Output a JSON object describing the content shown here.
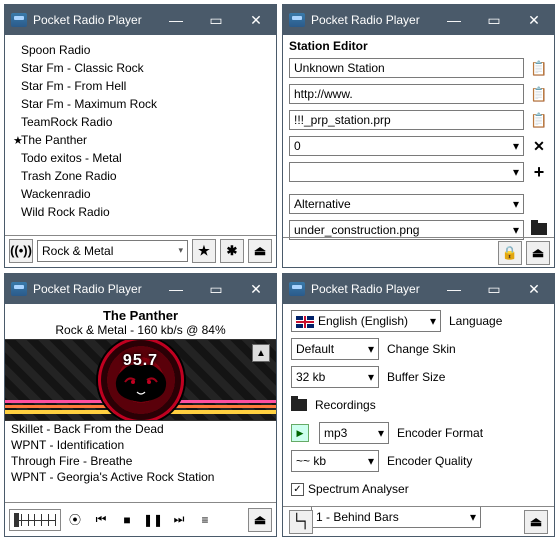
{
  "app_title": "Pocket Radio Player",
  "win_tl": {
    "stations": [
      "Spoon Radio",
      "Star Fm - Classic Rock",
      "Star Fm - From Hell",
      "Star Fm - Maximum Rock",
      "TeamRock Radio",
      "The Panther",
      "Todo exitos - Metal",
      "Trash Zone Radio",
      "Wackenradio",
      "Wild Rock Radio"
    ],
    "starred_index": 5,
    "genre": "Rock & Metal"
  },
  "win_tr": {
    "heading": "Station Editor",
    "name": "Unknown Station",
    "url": "http://www.",
    "file": "!!!_prp_station.prp",
    "bitrate": "0",
    "extra": "",
    "genre": "Alternative",
    "image": "under_construction.png"
  },
  "win_bl": {
    "now_title": "The Panther",
    "now_sub": "Rock & Metal - 160 kb/s @ 84%",
    "freq": "95.7",
    "history": [
      "Skillet - Back From the Dead",
      "WPNT - Identification",
      "Through Fire - Breathe",
      "WPNT - Georgia's Active Rock Station"
    ]
  },
  "win_br": {
    "language": "English (English)",
    "language_label": "Language",
    "skin": "Default",
    "skin_label": "Change Skin",
    "buffer": "32 kb",
    "buffer_label": "Buffer Size",
    "recordings_label": "Recordings",
    "enc_format": "mp3",
    "enc_format_label": "Encoder Format",
    "enc_quality": "~~ kb",
    "enc_quality_label": "Encoder Quality",
    "spectrum_label": "Spectrum Analyser",
    "spectrum_checked": true,
    "spectrum_style": "1 - Behind Bars"
  }
}
